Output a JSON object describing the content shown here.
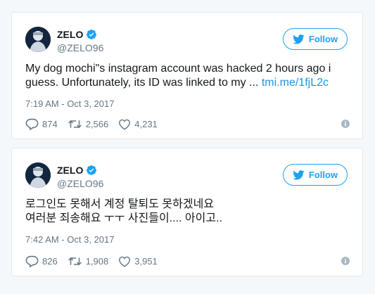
{
  "colors": {
    "accent": "#1da1f2",
    "link": "#1b95e0",
    "muted": "#657786",
    "border": "#e1e8ed",
    "background": "#f5f8fa"
  },
  "icons": [
    "verified-icon",
    "twitter-bird-icon",
    "reply-icon",
    "retweet-icon",
    "like-icon",
    "info-icon"
  ],
  "tweets": [
    {
      "author": {
        "name": "ZELO",
        "handle": "@ZELO96"
      },
      "follow_label": "Follow",
      "text_line_1": "My dog mochi\"s instagram account was hacked 2 hours ago i",
      "text_line_2": "guess. Unfortunately, its ID was linked to my ... ",
      "link_text": "tmi.me/1fjL2c",
      "timestamp": "7:19 AM - Oct 3, 2017",
      "replies": "874",
      "retweets": "2,566",
      "likes": "4,231"
    },
    {
      "author": {
        "name": "ZELO",
        "handle": "@ZELO96"
      },
      "follow_label": "Follow",
      "text_line_1": "로그인도 못해서 계정 탈퇴도 못하겠네요",
      "text_line_2": "여러분 죄송해요 ㅜㅜ 사진들이.... 아이고..",
      "timestamp": "7:42 AM - Oct 3, 2017",
      "replies": "826",
      "retweets": "1,908",
      "likes": "3,951"
    }
  ]
}
